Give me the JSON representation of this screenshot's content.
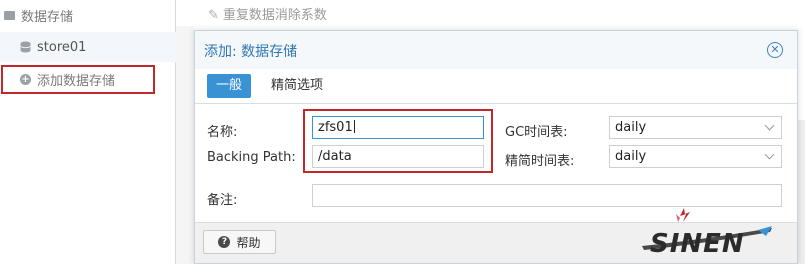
{
  "tree": {
    "root_label": "数据存储",
    "store_label": "store01",
    "add_label": "添加数据存储"
  },
  "toolbar": {
    "dedup_label": "重复数据消除系数"
  },
  "dialog": {
    "title": "添加: 数据存储",
    "tabs": [
      {
        "label": "一般",
        "active": true
      },
      {
        "label": "精简选项",
        "active": false
      }
    ],
    "fields": {
      "name_label": "名称:",
      "name_value": "zfs01",
      "path_label": "Backing Path:",
      "path_value": "/data",
      "gc_label": "GC时间表:",
      "gc_value": "daily",
      "prune_label": "精简时间表:",
      "prune_value": "daily",
      "comment_label": "备注:",
      "comment_value": ""
    },
    "help_label": "帮助"
  },
  "logo": {
    "text": "SINEN",
    "colors": {
      "primary": "#2b2b2b",
      "accent": "#c0282d"
    }
  },
  "colors": {
    "accent": "#3892d4",
    "title": "#2f76b7",
    "highlight_box": "#c0282d"
  }
}
